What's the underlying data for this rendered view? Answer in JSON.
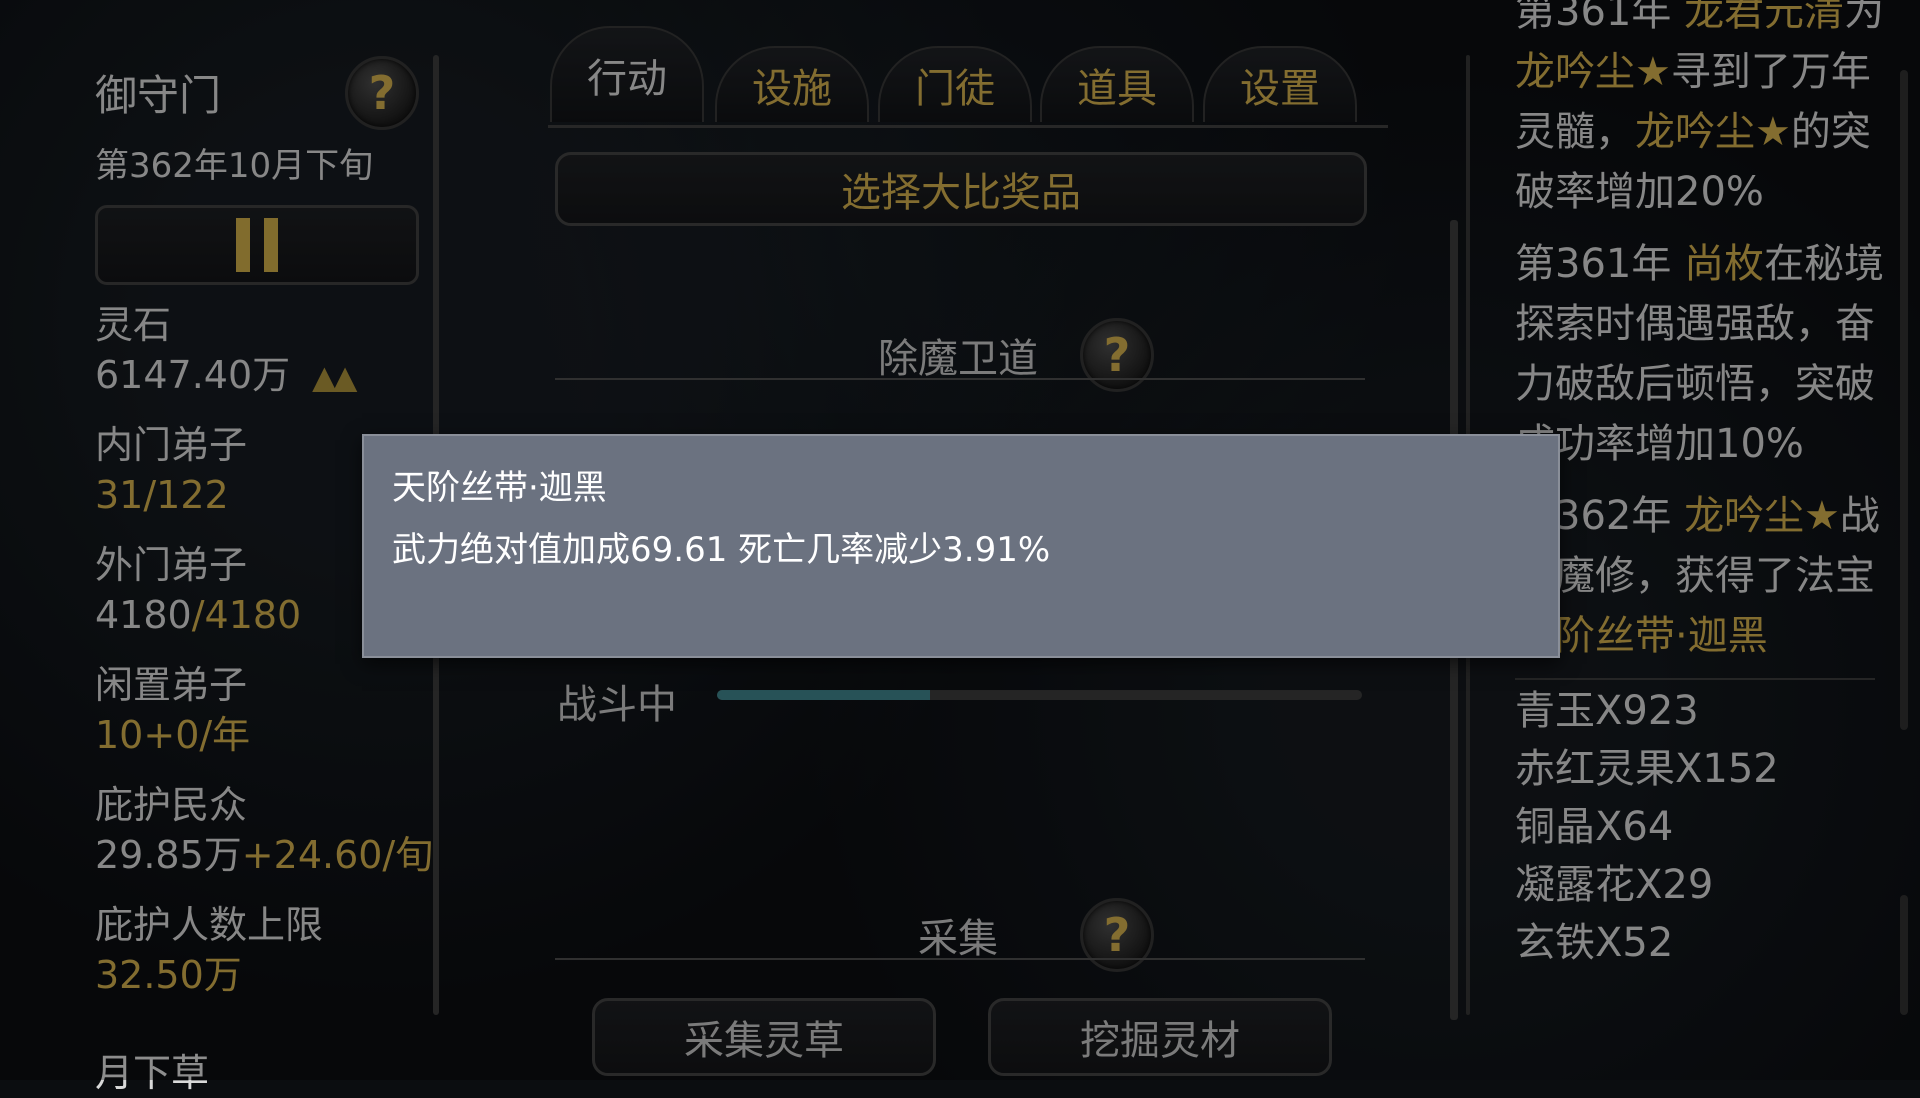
{
  "sidebar": {
    "sect_name": "御守门",
    "date": "第362年10月下旬",
    "spirit_stone_label": "灵石",
    "spirit_stone_value": "6147.40万",
    "spirit_stone_trend": "▲▲",
    "inner_label": "内门弟子",
    "inner_current": "31",
    "inner_max": "/122",
    "outer_label": "外门弟子",
    "outer_current": "4180",
    "outer_max": "/4180",
    "idle_label": "闲置弟子",
    "idle_value": "10",
    "idle_rate": "+0/年",
    "people_label": "庇护民众",
    "people_value": "29.85万",
    "people_rate": "+24.60/旬",
    "limit_label": "庇护人数上限",
    "limit_value": "32.50万",
    "month_grass": "月下草"
  },
  "tabs": [
    {
      "label": "行动"
    },
    {
      "label": "设施"
    },
    {
      "label": "门徒"
    },
    {
      "label": "道具"
    },
    {
      "label": "设置"
    }
  ],
  "main": {
    "select_prize": "选择大比奖品",
    "demon_section": "除魔卫道",
    "status": "战斗中",
    "progress": 0.33,
    "gather_section": "采集",
    "gather_herb": "采集灵草",
    "mine_material": "挖掘灵材"
  },
  "help_glyph": "?",
  "log": {
    "entry1_a": "第361年 ",
    "entry1_name": "龙君元清",
    "entry1_b": "为",
    "entry1_target": "龙吟尘★",
    "entry1_c": "寻到了万年灵髓，",
    "entry1_target2": "龙吟尘★",
    "entry1_d": "的突破率增加20%",
    "entry2_a": "第361年 ",
    "entry2_name": "尚枚",
    "entry2_b": "在秘境探索时偶遇强敌，奋力破敌后顿悟，突破成功率增加10%",
    "entry3_a": "第362年 ",
    "entry3_name": "龙吟尘★",
    "entry3_b": "战胜魔修，获得了法宝",
    "entry3_item": "天阶丝带·迦黑",
    "items": [
      "青玉X923",
      "赤红灵果X152",
      "铜晶X64",
      "凝露花X29",
      "玄铁X52"
    ]
  },
  "tooltip": {
    "title": "天阶丝带·迦黑",
    "desc": "武力绝对值加成69.61 死亡几率减少3.91%"
  },
  "colors": {
    "gold": "#c9a84a",
    "text": "#cfcfcf",
    "tooltip_bg": "#6b7280",
    "progress_fill": "#3d7f86"
  }
}
